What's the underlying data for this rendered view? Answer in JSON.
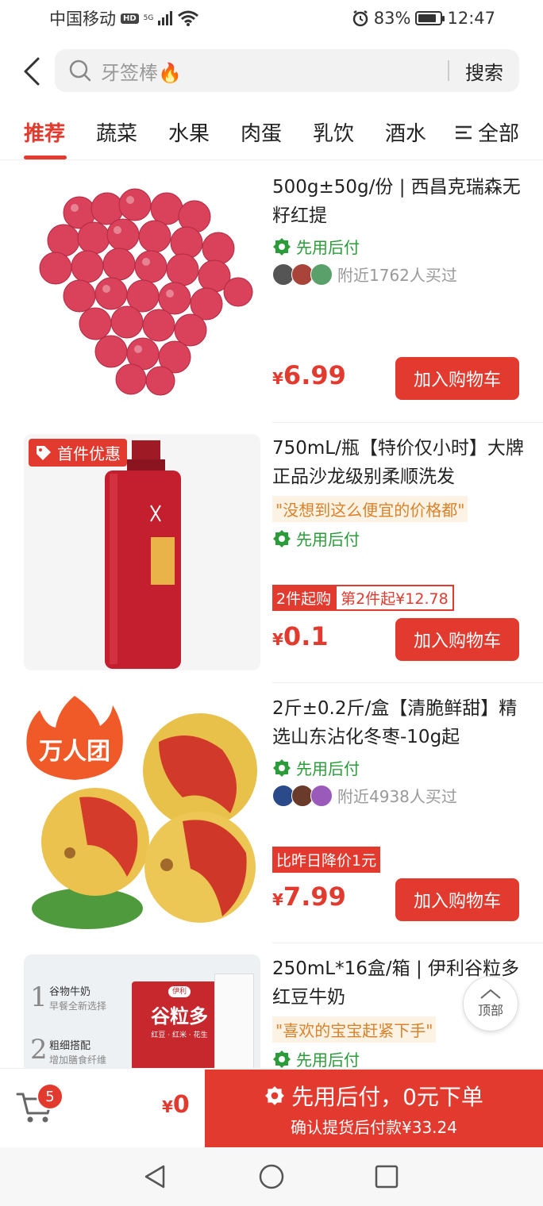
{
  "status_bar": {
    "carrier": "中国移动",
    "hd": "HD",
    "network": "5G",
    "battery": "83%",
    "battery_level": 0.83,
    "time": "12:47"
  },
  "search": {
    "placeholder": "牙签棒🔥",
    "button": "搜索"
  },
  "tabs": {
    "items": [
      "推荐",
      "蔬菜",
      "水果",
      "肉蛋",
      "乳饮",
      "酒水"
    ],
    "active_index": 0,
    "all_label": "全部"
  },
  "products": [
    {
      "title": "500g±50g/份 | 西昌克瑞森无籽红提",
      "pay_later": "先用后付",
      "buyers": "附近1762人买过",
      "price_symbol": "¥",
      "price": "6.99",
      "cart_button": "加入购物车"
    },
    {
      "badge": "首件优惠",
      "title": "750mL/瓶【特价仅小时】大牌正品沙龙级别柔顺洗发",
      "quote": "\"没想到这么便宜的价格都\"",
      "pay_later": "先用后付",
      "tag_min": "2件起购",
      "tag_second": "第2件起¥12.78",
      "price_symbol": "¥",
      "price": "0.1",
      "cart_button": "加入购物车"
    },
    {
      "badge": "万人团",
      "title": "2斤±0.2斤/盒【清脆鲜甜】精选山东沾化冬枣-10g起",
      "pay_later": "先用后付",
      "buyers": "附近4938人买过",
      "tag_drop": "比昨日降价1元",
      "price_symbol": "¥",
      "price": "7.99",
      "cart_button": "加入购物车"
    },
    {
      "title": "250mL*16盒/箱 | 伊利谷粒多红豆牛奶",
      "quote": "\"喜欢的宝宝赶紧下手\"",
      "pay_later": "先用后付",
      "image_text": {
        "line1": "谷物牛奶",
        "line1_sub": "早餐全新选择",
        "line2": "粗细搭配",
        "line2_sub": "增加膳食纤维",
        "num1": "1",
        "num2": "2",
        "brand_logo": "伊利",
        "brand": "谷粒多",
        "brand_sub": "红豆 · 红米 · 花生"
      }
    }
  ],
  "top_button": "顶部",
  "bottom_bar": {
    "cart_count": "5",
    "total_symbol": "¥",
    "total": "0",
    "checkout_main": "先用后付，0元下单",
    "checkout_sub": "确认提货后付款¥33.24"
  },
  "colors": {
    "accent": "#e23a2e",
    "pay_green": "#2a9d3a",
    "quote_orange": "#d9822b"
  }
}
